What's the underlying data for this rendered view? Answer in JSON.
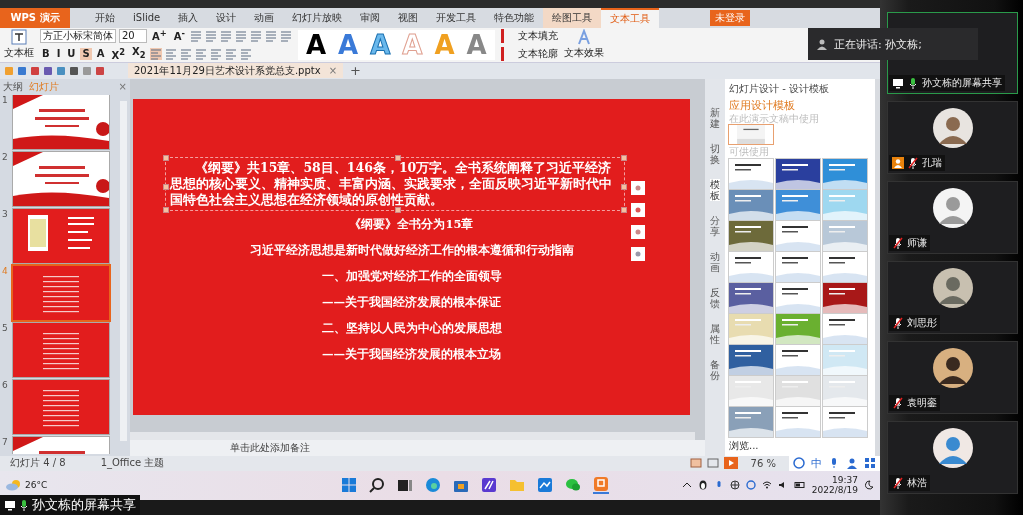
{
  "app": {
    "menu_button": "WPS 演示",
    "tabs": [
      {
        "label": "开始",
        "selected": false,
        "kind": "normal"
      },
      {
        "label": "iSlide",
        "selected": false,
        "kind": "normal"
      },
      {
        "label": "插入",
        "selected": false,
        "kind": "normal"
      },
      {
        "label": "设计",
        "selected": false,
        "kind": "normal"
      },
      {
        "label": "动画",
        "selected": false,
        "kind": "normal"
      },
      {
        "label": "幻灯片放映",
        "selected": false,
        "kind": "normal"
      },
      {
        "label": "审阅",
        "selected": false,
        "kind": "normal"
      },
      {
        "label": "视图",
        "selected": false,
        "kind": "normal"
      },
      {
        "label": "开发工具",
        "selected": false,
        "kind": "normal"
      },
      {
        "label": "特色功能",
        "selected": false,
        "kind": "normal"
      },
      {
        "label": "绘图工具",
        "selected": false,
        "kind": "context"
      },
      {
        "label": "文本工具",
        "selected": true,
        "kind": "context"
      }
    ],
    "login": "未登录"
  },
  "ribbon": {
    "textbox": "文本框",
    "font": "方正小标宋简体",
    "size": "20",
    "grow": "A$^{+}$",
    "shrink": "A$^{-}$",
    "format": [
      {
        "label": "B",
        "selected": false
      },
      {
        "label": "I",
        "selected": false
      },
      {
        "label": "U",
        "selected": false
      },
      {
        "label": "S",
        "selected": true
      },
      {
        "label": "A",
        "selected": false
      },
      {
        "label": "X$^{2}$",
        "selected": false
      },
      {
        "label": "X$_{2}$",
        "selected": false
      }
    ],
    "art": [
      {
        "label": "A",
        "kind": "solid"
      },
      {
        "label": "A",
        "kind": "blue"
      },
      {
        "label": "A",
        "kind": "outline-blue"
      },
      {
        "label": "A",
        "kind": "outline-pink"
      },
      {
        "label": "A",
        "kind": "orange"
      },
      {
        "label": "A",
        "kind": "grey"
      }
    ],
    "fill": "文本填充",
    "outline": "文本轮廓",
    "effect": "文本效果"
  },
  "document_tab": {
    "title": "2021年11月29日艺术设计系党总支.pptx",
    "close": "×",
    "new": "+"
  },
  "slides_panel": {
    "tabs": [
      {
        "label": "大纲",
        "selected": false
      },
      {
        "label": "幻灯片",
        "selected": true
      }
    ],
    "close": "×",
    "slides": [
      {
        "number": "1",
        "kind": "cover",
        "selected": false
      },
      {
        "number": "2",
        "kind": "cover",
        "selected": false
      },
      {
        "number": "3",
        "kind": "book",
        "selected": false
      },
      {
        "number": "4",
        "kind": "text",
        "selected": true
      },
      {
        "number": "5",
        "kind": "text",
        "selected": false
      },
      {
        "number": "6",
        "kind": "text",
        "selected": false
      },
      {
        "number": "7",
        "kind": "cover",
        "selected": false
      }
    ]
  },
  "slide": {
    "paragraph": "《纲要》共15章、58目、146条，10万字。全书系统阐释了习近平经济思想的核心要义、精神实质、丰富内涵、实践要求，全面反映习近平新时代中国特色社会主义思想在经济领域的原创性贡献。",
    "lines": [
      "《纲要》全书分为15章",
      "习近平经济思想是新时代做好经济工作的根本遵循和行动指南",
      "一、加强党对经济工作的全面领导",
      "——关于我国经济发展的根本保证",
      "二、坚持以人民为中心的发展思想",
      "——关于我国经济发展的根本立场"
    ]
  },
  "notes": {
    "placeholder": "单击此处添加备注"
  },
  "side_tabs": [
    {
      "label": "新建",
      "selected": false
    },
    {
      "label": "切换",
      "selected": false
    },
    {
      "label": "模板",
      "selected": true
    },
    {
      "label": "分享",
      "selected": false
    },
    {
      "label": "动画",
      "selected": false
    },
    {
      "label": "反馈",
      "selected": false
    },
    {
      "label": "属性",
      "selected": false
    },
    {
      "label": "备份",
      "selected": false
    }
  ],
  "task_pane": {
    "title": "幻灯片设计 - 设计模板",
    "heading": "应用设计模板",
    "section_current": "在此演示文稿中使用",
    "section_available": "可供使用",
    "browse": "浏览..."
  },
  "status_bar": {
    "slide": "幻灯片 4 / 8",
    "theme": "1_Office 主题",
    "zoom": "76 %",
    "ime": "中"
  },
  "taskbar": {
    "weather": "26°C",
    "time": "19:37",
    "date": "2022/8/19"
  },
  "meeting": {
    "speaking": "正在讲话: 孙文栋;",
    "share_label": "孙文栋的屏幕共享",
    "participants": [
      {
        "name": "孔瑞",
        "muted": true,
        "host": true
      },
      {
        "name": "师谦",
        "muted": true,
        "host": false
      },
      {
        "name": "刘思彤",
        "muted": true,
        "host": false
      },
      {
        "name": "袁明銮",
        "muted": true,
        "host": false
      },
      {
        "name": "林浩",
        "muted": true,
        "host": false
      }
    ],
    "bottom_share_label": "孙文栋的屏幕共享"
  }
}
